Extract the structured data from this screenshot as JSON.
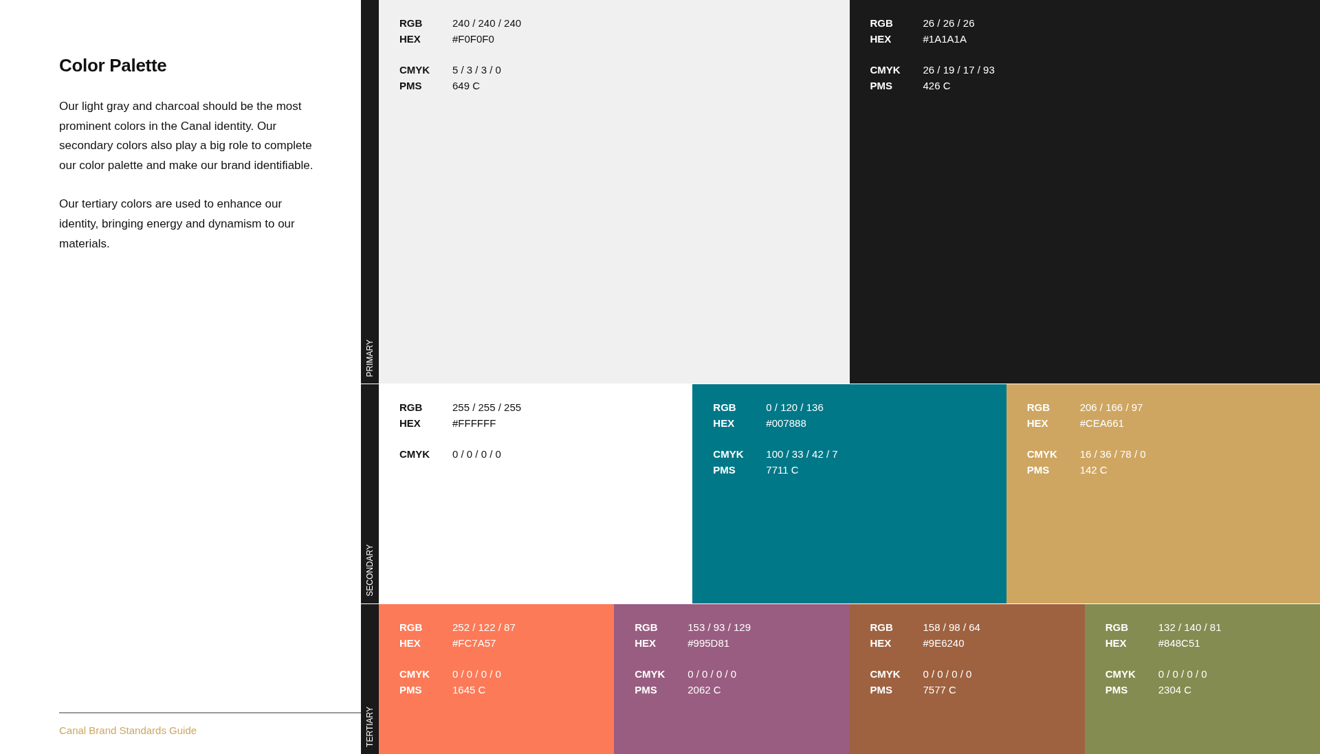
{
  "title": "Color Palette",
  "paragraphs": [
    "Our light gray and charcoal should be the most prominent colors in the Canal identity. Our secondary colors also play a big role to complete our color palette and make our brand identifiable.",
    "Our tertiary colors are used to enhance our identity, bringing energy and dynamism to our materials."
  ],
  "footer": "Canal Brand Standards Guide",
  "groups": [
    {
      "label": "PRIMARY",
      "swatches": [
        {
          "color": "#f0f0f0",
          "specs": [
            [
              {
                "label": "RGB",
                "value": "240 / 240 / 240"
              },
              {
                "label": "HEX",
                "value": "#F0F0F0"
              }
            ],
            [
              {
                "label": "CMYK",
                "value": "5 / 3 / 3 / 0"
              },
              {
                "label": "PMS",
                "value": "649 C"
              }
            ]
          ]
        },
        {
          "color": "#1a1a1a",
          "specs": [
            [
              {
                "label": "RGB",
                "value": "26 / 26 / 26"
              },
              {
                "label": "HEX",
                "value": "#1A1A1A"
              }
            ],
            [
              {
                "label": "CMYK",
                "value": "26 / 19 / 17 / 93"
              },
              {
                "label": "PMS",
                "value": "426 C"
              }
            ]
          ]
        }
      ]
    },
    {
      "label": "SECONDARY",
      "swatches": [
        {
          "color": "#ffffff",
          "specs": [
            [
              {
                "label": "RGB",
                "value": "255 / 255 / 255"
              },
              {
                "label": "HEX",
                "value": "#FFFFFF"
              }
            ],
            [
              {
                "label": "CMYK",
                "value": "0 / 0 / 0 / 0"
              }
            ]
          ]
        },
        {
          "color": "#007888",
          "specs": [
            [
              {
                "label": "RGB",
                "value": "0 / 120 / 136"
              },
              {
                "label": "HEX",
                "value": "#007888"
              }
            ],
            [
              {
                "label": "CMYK",
                "value": "100 / 33 / 42 / 7"
              },
              {
                "label": "PMS",
                "value": "7711 C"
              }
            ]
          ]
        },
        {
          "color": "#cea661",
          "specs": [
            [
              {
                "label": "RGB",
                "value": "206 / 166 / 97"
              },
              {
                "label": "HEX",
                "value": "#CEA661"
              }
            ],
            [
              {
                "label": "CMYK",
                "value": "16 / 36 / 78 / 0"
              },
              {
                "label": "PMS",
                "value": "142 C"
              }
            ]
          ]
        }
      ]
    },
    {
      "label": "TERTIARY",
      "swatches": [
        {
          "color": "#fc7a57",
          "specs": [
            [
              {
                "label": "RGB",
                "value": "252 / 122 / 87"
              },
              {
                "label": "HEX",
                "value": "#FC7A57"
              }
            ],
            [
              {
                "label": "CMYK",
                "value": "0 / 0 / 0 / 0"
              },
              {
                "label": "PMS",
                "value": "1645 C"
              }
            ]
          ]
        },
        {
          "color": "#995d81",
          "specs": [
            [
              {
                "label": "RGB",
                "value": "153 / 93 / 129"
              },
              {
                "label": "HEX",
                "value": "#995D81"
              }
            ],
            [
              {
                "label": "CMYK",
                "value": "0 / 0 / 0 / 0"
              },
              {
                "label": "PMS",
                "value": "2062 C"
              }
            ]
          ]
        },
        {
          "color": "#9e6240",
          "specs": [
            [
              {
                "label": "RGB",
                "value": "158 / 98 / 64"
              },
              {
                "label": "HEX",
                "value": "#9E6240"
              }
            ],
            [
              {
                "label": "CMYK",
                "value": "0 / 0 / 0 / 0"
              },
              {
                "label": "PMS",
                "value": "7577 C"
              }
            ]
          ]
        },
        {
          "color": "#848c51",
          "specs": [
            [
              {
                "label": "RGB",
                "value": "132 / 140 / 81"
              },
              {
                "label": "HEX",
                "value": "#848C51"
              }
            ],
            [
              {
                "label": "CMYK",
                "value": "0 / 0 / 0 / 0"
              },
              {
                "label": "PMS",
                "value": "2304 C"
              }
            ]
          ]
        }
      ]
    }
  ]
}
